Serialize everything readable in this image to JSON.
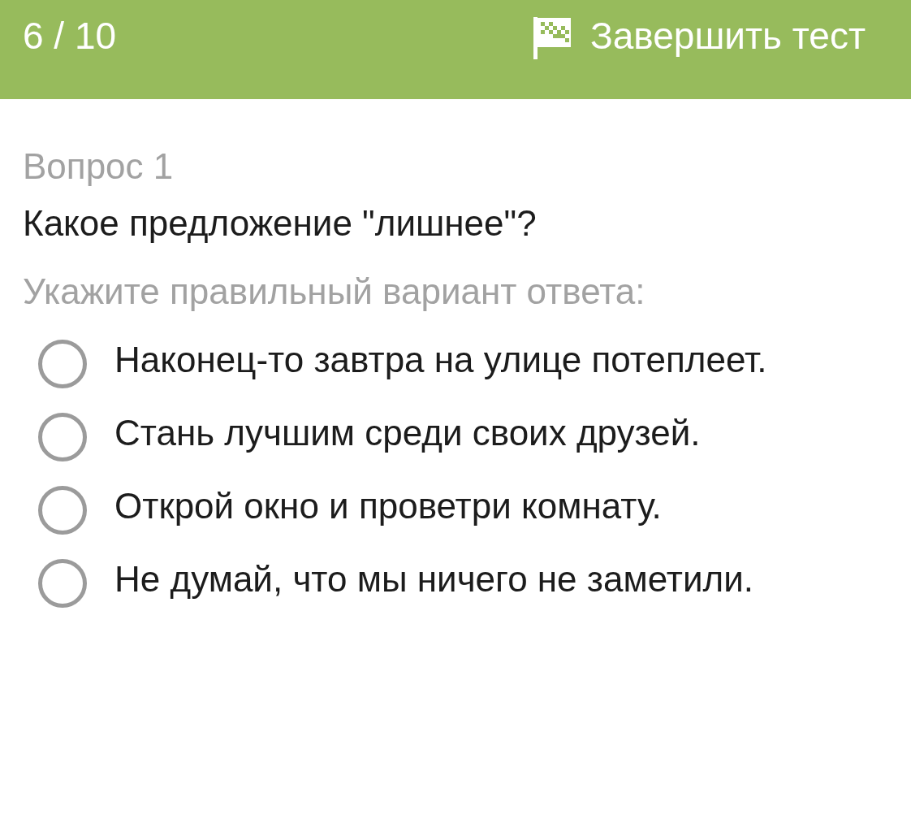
{
  "header": {
    "progress": "6 / 10",
    "finish_button": "Завершить тест"
  },
  "question": {
    "number": "Вопрос 1",
    "text": "Какое предложение \"лишнее\"?",
    "instruction": "Укажите правильный вариант ответа:",
    "options": [
      {
        "label": "Наконец-то завтра на улице потеплеет.",
        "selected": false
      },
      {
        "label": "Стань лучшим среди своих друзей.",
        "selected": false
      },
      {
        "label": "Открой окно и проветри комнату.",
        "selected": false
      },
      {
        "label": "Не думай, что мы ничего не заметили.",
        "selected": false
      }
    ]
  }
}
